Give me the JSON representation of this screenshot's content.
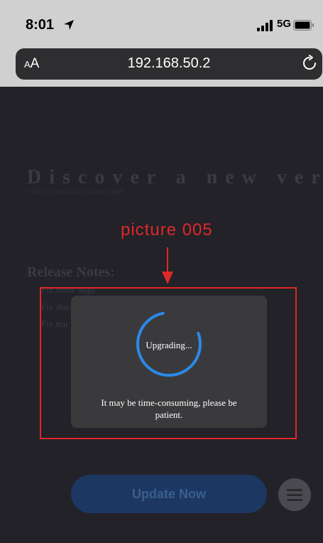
{
  "status_bar": {
    "time": "8:01",
    "network": "5G",
    "icons": [
      "location-arrow-icon",
      "signal-bars-icon",
      "battery-icon"
    ]
  },
  "browser": {
    "text_size_label_small": "A",
    "text_size_label_large": "A",
    "url": "192.168.50.2",
    "icons": [
      "reload-icon"
    ]
  },
  "page": {
    "title": "Discover a new version",
    "version_info": "VER:2021.06.06.1543 | Size:6.93MB",
    "release_notes_heading": "Release Notes:",
    "release_notes": [
      "Fix some bugs",
      "Fix disc",
      "Fix mic"
    ]
  },
  "annotation": {
    "label": "picture 005",
    "color": "#e02828"
  },
  "modal": {
    "status": "Upgrading...",
    "message": "It may be time-consuming, please be patient.",
    "spinner_color": "#2b8ae8"
  },
  "actions": {
    "update_label": "Update Now",
    "menu_icon": "hamburger-menu-icon"
  }
}
